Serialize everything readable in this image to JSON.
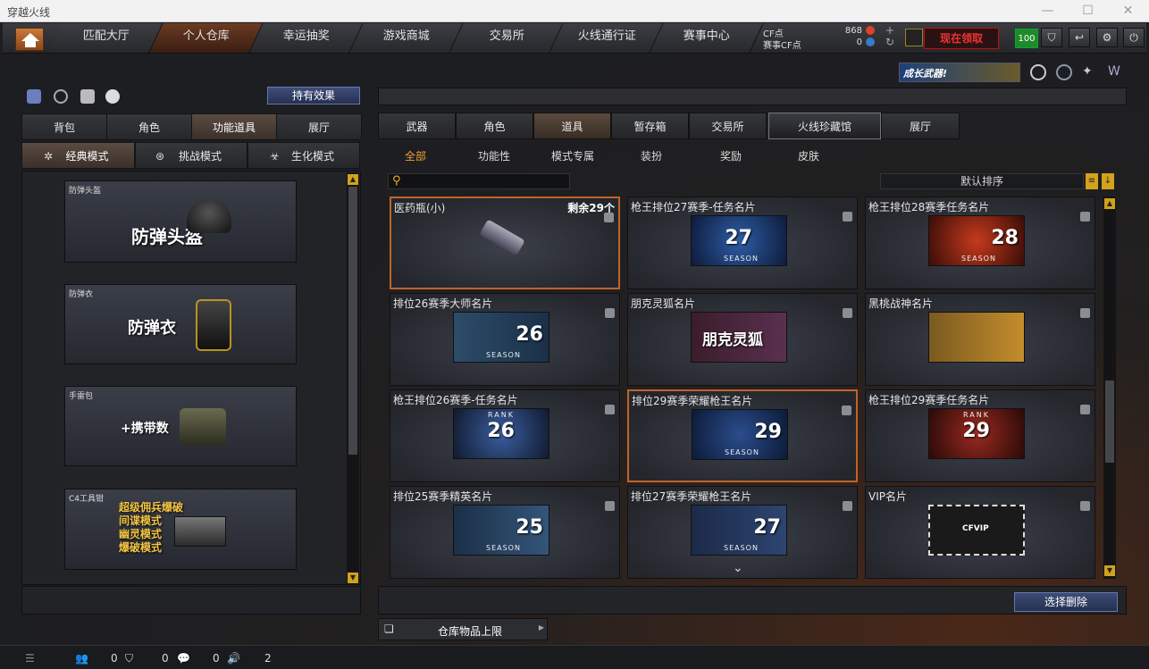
{
  "window": {
    "title": "穿越火线"
  },
  "nav": {
    "tabs": [
      "匹配大厅",
      "个人仓库",
      "幸运抽奖",
      "游戏商城",
      "交易所",
      "火线通行证",
      "赛事中心"
    ],
    "cf_label": "CF点",
    "event_cf_label": "赛事CF点",
    "cf_value": "868",
    "event_cf_value": "0",
    "promo_text": "现在领取",
    "level": "100"
  },
  "left": {
    "effects_button": "持有效果",
    "tabs": [
      "背包",
      "角色",
      "功能道具",
      "展厅"
    ],
    "modes": [
      "经典模式",
      "挑战模式",
      "生化模式"
    ],
    "cards": [
      {
        "caption": "防弹头盔",
        "title": "防弹头盔"
      },
      {
        "caption": "防弹衣",
        "title": "防弹衣"
      },
      {
        "caption": "手雷包",
        "title": "+携带数"
      },
      {
        "caption": "C4工具钳",
        "lines": [
          "超级佣兵爆破",
          "间谍模式",
          "幽灵模式",
          "爆破模式"
        ]
      }
    ]
  },
  "right": {
    "banner": "成长武器!",
    "tabs": [
      "武器",
      "角色",
      "道具",
      "暂存箱",
      "交易所",
      "火线珍藏馆",
      "展厅"
    ],
    "filters": [
      "全部",
      "功能性",
      "模式专属",
      "装扮",
      "奖励",
      "皮肤"
    ],
    "search_placeholder": "",
    "sort": "默认排序",
    "items": [
      {
        "name": "医药瓶(小)",
        "extra": "剩余29个",
        "pic": "medkit"
      },
      {
        "name": "枪王排位27赛季-任务名片",
        "pic": "s27"
      },
      {
        "name": "枪王排位28赛季任务名片",
        "pic": "s28"
      },
      {
        "name": "排位26赛季大师名片",
        "pic": "s26"
      },
      {
        "name": "朋克灵狐名片",
        "pic": "punk",
        "pic_text": "朋克灵狐"
      },
      {
        "name": "黑桃战神名片",
        "pic": "ace"
      },
      {
        "name": "枪王排位26赛季-任务名片",
        "pic": "r26"
      },
      {
        "name": "排位29赛季荣耀枪王名片",
        "pic": "s29"
      },
      {
        "name": "枪王排位29赛季任务名片",
        "pic": "r29"
      },
      {
        "name": "排位25赛季精英名片",
        "pic": "s25"
      },
      {
        "name": "排位27赛季荣耀枪王名片",
        "pic": "g27"
      },
      {
        "name": "VIP名片",
        "pic": "vip"
      }
    ],
    "pic_labels": {
      "season": "SEASON",
      "rank": "RANK",
      "n25": "25",
      "n26": "26",
      "n27": "27",
      "n28": "28",
      "n29": "29",
      "vip": "CFVIP"
    },
    "delete_button": "选择删除",
    "storage_limit": "仓库物品上限"
  },
  "status": {
    "a": "0",
    "b": "0",
    "c": "0",
    "d": "2"
  },
  "colors": {
    "accent": "#c0632b",
    "gold": "#f4c542"
  }
}
